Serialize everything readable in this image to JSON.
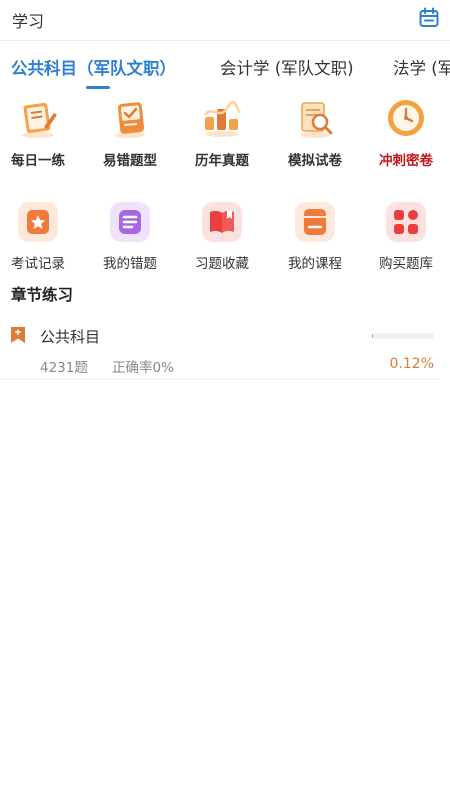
{
  "header": {
    "title": "学习",
    "calendar_icon": "calendar-icon"
  },
  "tabs": [
    {
      "label": "公共科目（军队文职）",
      "active": true
    },
    {
      "label": "会计学 (军队文职)",
      "active": false
    },
    {
      "label": "法学 (军",
      "active": false
    }
  ],
  "quick_actions": [
    {
      "label": "每日一练",
      "icon": "daily-practice-icon"
    },
    {
      "label": "易错题型",
      "icon": "error-prone-icon"
    },
    {
      "label": "历年真题",
      "icon": "past-papers-icon"
    },
    {
      "label": "模拟试卷",
      "icon": "mock-exam-icon"
    },
    {
      "label": "冲刺密卷",
      "icon": "sprint-exam-icon",
      "color": "#c4161c"
    }
  ],
  "tools": [
    {
      "label": "考试记录",
      "icon": "exam-record-icon"
    },
    {
      "label": "我的错题",
      "icon": "my-mistakes-icon"
    },
    {
      "label": "习题收藏",
      "icon": "favorites-icon"
    },
    {
      "label": "我的课程",
      "icon": "my-courses-icon"
    },
    {
      "label": "购买题库",
      "icon": "buy-bank-icon"
    }
  ],
  "section": {
    "title": "章节练习"
  },
  "chapter": {
    "name": "公共科目",
    "question_count": "4231题",
    "accuracy": "正确率0%",
    "progress_text": "0.12%",
    "progress_fraction": 0.0012
  },
  "colors": {
    "accent": "#2d7fd0",
    "orange": "#e07a3a",
    "red": "#c4161c"
  }
}
